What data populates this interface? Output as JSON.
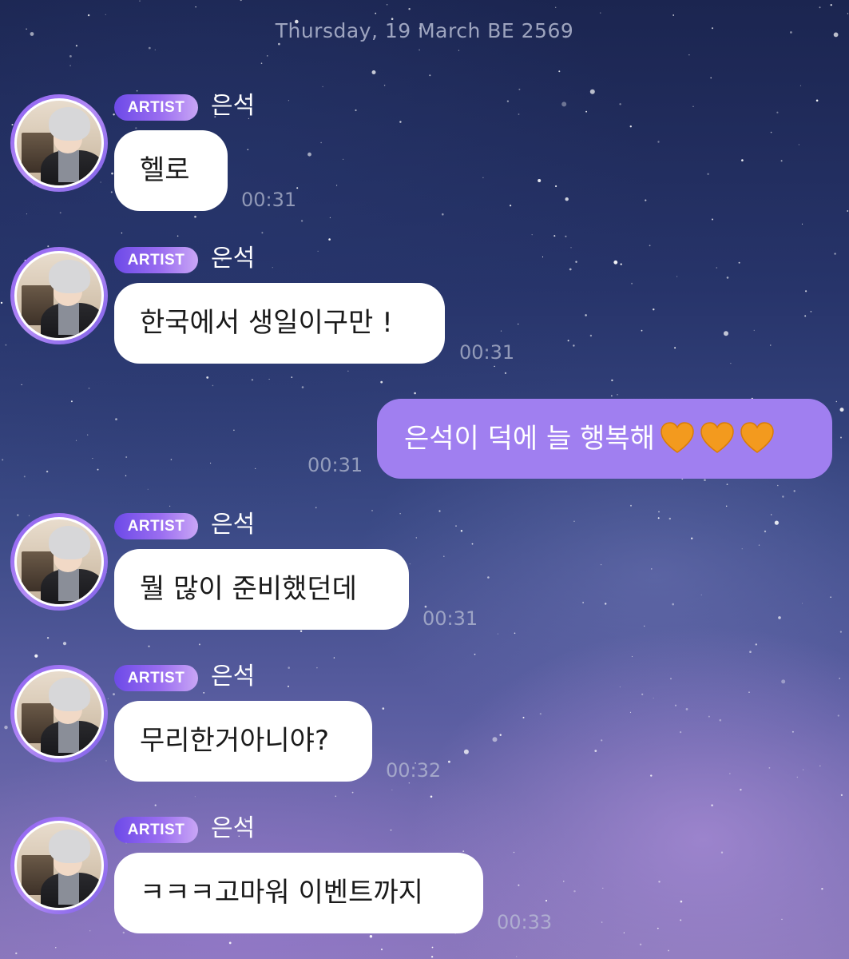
{
  "date_header": "Thursday, 19 March BE 2569",
  "messages": [
    {
      "badge": "ARTIST",
      "sender": "은석",
      "text": "헬로",
      "time": "00:31"
    },
    {
      "badge": "ARTIST",
      "sender": "은석",
      "text": "한국에서 생일이구만 !",
      "time": "00:31"
    },
    {
      "text": "은석이 덕에 늘 행복해",
      "emoji": "orange-heart-icon",
      "emoji_count": 3,
      "time": "00:31"
    },
    {
      "badge": "ARTIST",
      "sender": "은석",
      "text": "뭘 많이 준비했던데",
      "time": "00:31"
    },
    {
      "badge": "ARTIST",
      "sender": "은석",
      "text": "무리한거아니야?",
      "time": "00:32"
    },
    {
      "badge": "ARTIST",
      "sender": "은석",
      "text": "ㅋㅋㅋ고마워 이벤트까지",
      "time": "00:33"
    }
  ],
  "colors": {
    "badge_gradient_start": "#6d4ae8",
    "badge_gradient_end": "#c9a6f6",
    "outgoing_bubble": "#a07ff0",
    "incoming_bubble": "#ffffff",
    "heart": "#f39a1e"
  }
}
